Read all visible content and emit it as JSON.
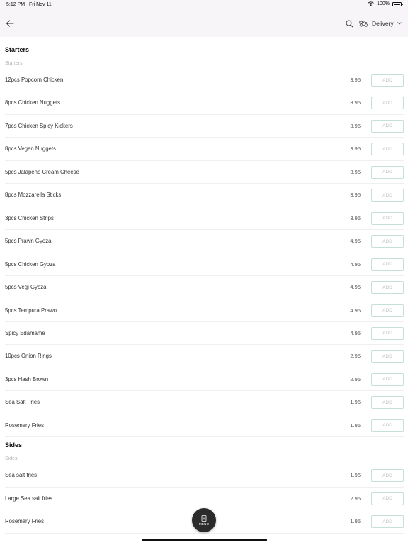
{
  "status_bar": {
    "time": "5:12 PM",
    "date": "Fri Nov 11",
    "battery": "100%"
  },
  "header": {
    "delivery_label": "Delivery"
  },
  "sections": [
    {
      "title": "Starters",
      "subtitle": "Starters",
      "items": [
        {
          "name": "12pcs Popcorn Chicken",
          "price": "3.95",
          "add": "ADD"
        },
        {
          "name": "8pcs Chicken Nuggets",
          "price": "3.95",
          "add": "ADD"
        },
        {
          "name": "7pcs Chicken Spicy Kickers",
          "price": "3.95",
          "add": "ADD"
        },
        {
          "name": "8pcs Vegan Nuggets",
          "price": "3.95",
          "add": "ADD"
        },
        {
          "name": "5pcs Jalapeno Cream Cheese",
          "price": "3.95",
          "add": "ADD"
        },
        {
          "name": "8pcs Mozzarella Sticks",
          "price": "3.95",
          "add": "ADD"
        },
        {
          "name": "3pcs Chicken Strips",
          "price": "3.95",
          "add": "ADD"
        },
        {
          "name": "5pcs Prawn Gyoza",
          "price": "4.95",
          "add": "ADD"
        },
        {
          "name": "5pcs Chicken Gyoza",
          "price": "4.95",
          "add": "ADD"
        },
        {
          "name": "5pcs Vegi Gyoza",
          "price": "4.95",
          "add": "ADD"
        },
        {
          "name": "5pcs Tempura Prawn",
          "price": "4.95",
          "add": "ADD"
        },
        {
          "name": "Spicy Edamame",
          "price": "4.95",
          "add": "ADD"
        },
        {
          "name": "10pcs Onion Rings",
          "price": "2.95",
          "add": "ADD"
        },
        {
          "name": "3pcs Hash Brown",
          "price": "2.95",
          "add": "ADD"
        },
        {
          "name": "Sea Salt Fries",
          "price": "1.95",
          "add": "ADD"
        },
        {
          "name": "Rosemary Fries",
          "price": "1.95",
          "add": "ADD"
        }
      ]
    },
    {
      "title": "Sides",
      "subtitle": "Sides",
      "items": [
        {
          "name": "Sea salt fries",
          "price": "1.95",
          "add": "ADD"
        },
        {
          "name": "Large Sea salt fries",
          "price": "2.95",
          "add": "ADD"
        },
        {
          "name": "Rosemary Fries",
          "price": "1.95",
          "add": "ADD"
        }
      ]
    }
  ],
  "menu_button": {
    "label": "MENU"
  }
}
